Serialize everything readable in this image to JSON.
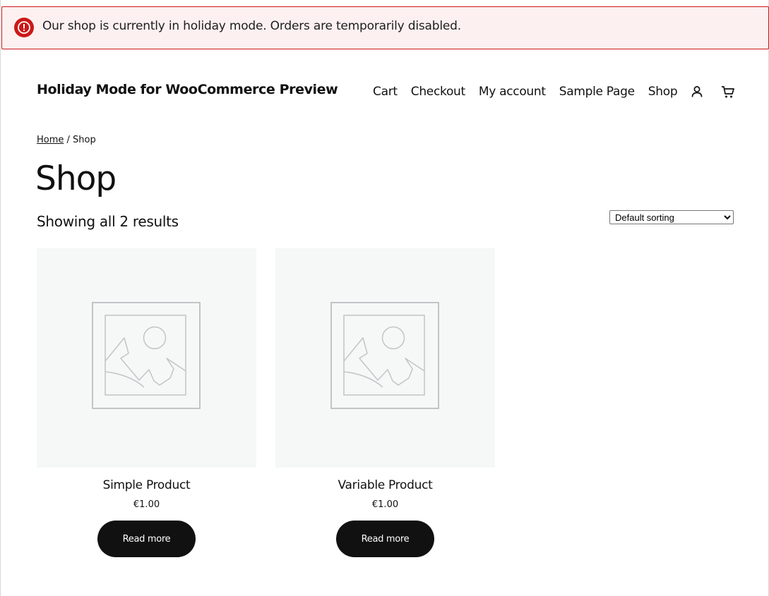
{
  "notice": {
    "text": "Our shop is currently in holiday mode. Orders are temporarily disabled.",
    "icon": "error-icon",
    "color": "#cc1818",
    "background": "#fcf0f1"
  },
  "header": {
    "site_title": "Holiday Mode for WooCommerce Preview",
    "nav": [
      {
        "label": "Cart"
      },
      {
        "label": "Checkout"
      },
      {
        "label": "My account"
      },
      {
        "label": "Sample Page"
      },
      {
        "label": "Shop"
      }
    ],
    "account_icon": "user-icon",
    "cart_icon": "cart-icon"
  },
  "breadcrumb": {
    "home": "Home",
    "separator": " / ",
    "current": "Shop"
  },
  "page": {
    "title": "Shop",
    "result_count": "Showing all 2 results",
    "sorting": {
      "selected": "Default sorting"
    }
  },
  "products": [
    {
      "name": "Simple Product",
      "price": "€1.00",
      "button": "Read more",
      "image": "placeholder-image-icon"
    },
    {
      "name": "Variable Product",
      "price": "€1.00",
      "button": "Read more",
      "image": "placeholder-image-icon"
    }
  ],
  "colors": {
    "button_bg": "#111111",
    "image_bg": "#f6f7f7"
  }
}
